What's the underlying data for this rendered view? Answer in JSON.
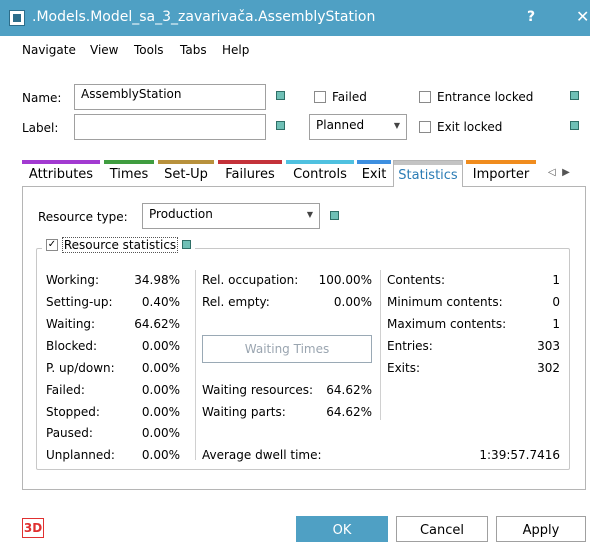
{
  "window": {
    "title": ".Models.Model_sa_3_zavarivača.AssemblyStation",
    "help_label": "?",
    "close_label": "✕"
  },
  "menu": [
    "Navigate",
    "View",
    "Tools",
    "Tabs",
    "Help"
  ],
  "form": {
    "name_label": "Name:",
    "name_value": "AssemblyStation",
    "label_label": "Label:",
    "label_value": "",
    "failed_label": "Failed",
    "planned_value": "Planned",
    "entrance_locked_label": "Entrance locked",
    "exit_locked_label": "Exit locked"
  },
  "tabs": [
    {
      "label": "Attributes",
      "color": "#a23ad1"
    },
    {
      "label": "Times",
      "color": "#3f9d3f"
    },
    {
      "label": "Set-Up",
      "color": "#b8913c"
    },
    {
      "label": "Failures",
      "color": "#c4323a"
    },
    {
      "label": "Controls",
      "color": "#4fc1e0"
    },
    {
      "label": "Exit",
      "color": "#3d8fe0"
    },
    {
      "label": "Statistics",
      "color": "#c4c4c4"
    },
    {
      "label": "Importer",
      "color": "#f08c1e"
    }
  ],
  "statistics": {
    "resource_type_label": "Resource type:",
    "resource_type_value": "Production",
    "resource_statistics_label": "Resource statistics",
    "col1": [
      {
        "label": "Working:",
        "value": "34.98%"
      },
      {
        "label": "Setting-up:",
        "value": "0.40%"
      },
      {
        "label": "Waiting:",
        "value": "64.62%"
      },
      {
        "label": "Blocked:",
        "value": "0.00%"
      },
      {
        "label": "P. up/down:",
        "value": "0.00%"
      },
      {
        "label": "Failed:",
        "value": "0.00%"
      },
      {
        "label": "Stopped:",
        "value": "0.00%"
      },
      {
        "label": "Paused:",
        "value": "0.00%"
      },
      {
        "label": "Unplanned:",
        "value": "0.00%"
      }
    ],
    "rel_occupation_label": "Rel. occupation:",
    "rel_occupation_value": "100.00%",
    "rel_empty_label": "Rel. empty:",
    "rel_empty_value": "0.00%",
    "waiting_times_button": "Waiting Times",
    "waiting_resources_label": "Waiting resources:",
    "waiting_resources_value": "64.62%",
    "waiting_parts_label": "Waiting parts:",
    "waiting_parts_value": "64.62%",
    "average_dwell_label": "Average dwell time:",
    "average_dwell_value": "1:39:57.7416",
    "col3": [
      {
        "label": "Contents:",
        "value": "1"
      },
      {
        "label": "Minimum contents:",
        "value": "0"
      },
      {
        "label": "Maximum contents:",
        "value": "1"
      },
      {
        "label": "Entries:",
        "value": "303"
      },
      {
        "label": "Exits:",
        "value": "302"
      }
    ]
  },
  "footer": {
    "logo": "3D",
    "ok_label": "OK",
    "cancel_label": "Cancel",
    "apply_label": "Apply"
  }
}
